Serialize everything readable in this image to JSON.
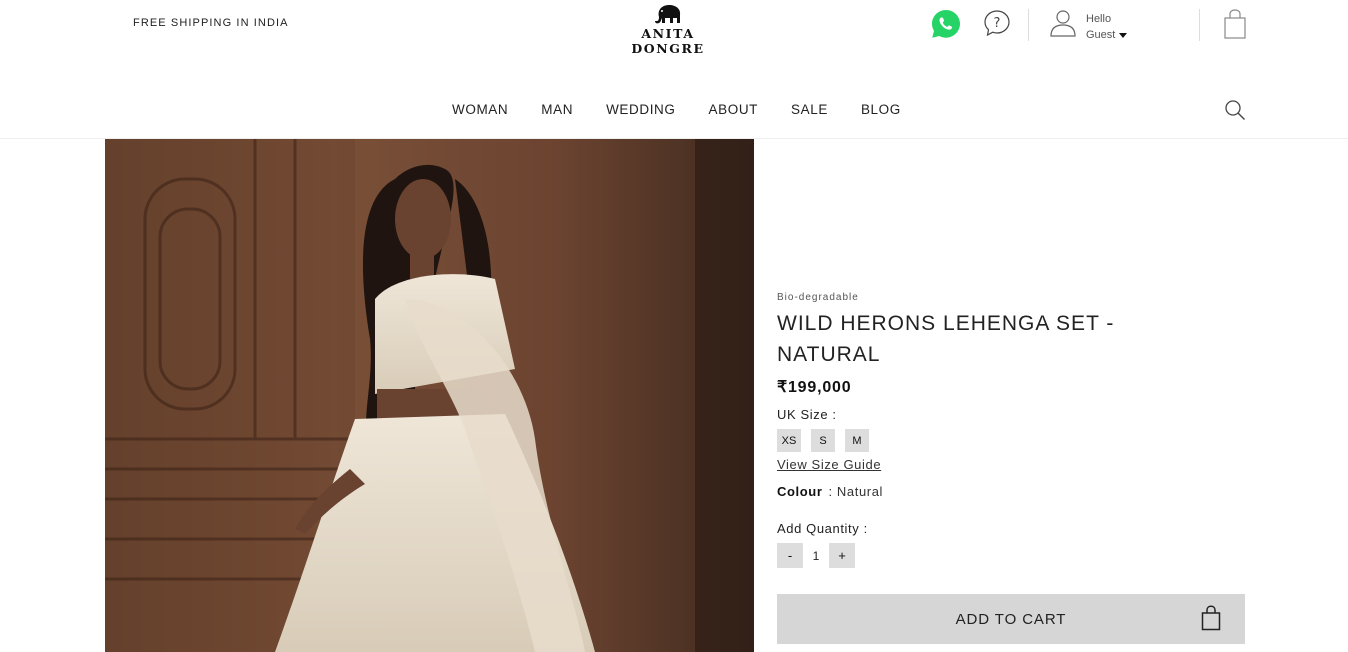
{
  "header": {
    "shipping_note": "FREE SHIPPING IN INDIA",
    "logo_text": "ANITA DONGRE",
    "account_greeting": "Hello",
    "account_name": "Guest",
    "icons": [
      "whatsapp-icon",
      "help-icon",
      "user-icon",
      "cart-icon",
      "search-icon"
    ]
  },
  "nav": {
    "items": [
      "WOMAN",
      "MAN",
      "WEDDING",
      "ABOUT",
      "SALE",
      "BLOG"
    ]
  },
  "product": {
    "tag": "Bio-degradable",
    "title": "WILD HERONS LEHENGA SET - NATURAL",
    "price": "₹199,000",
    "size_label": "UK Size  :",
    "sizes": [
      "XS",
      "S",
      "M"
    ],
    "size_guide": "View Size Guide",
    "colour_label": "Colour",
    "colour_value": ":  Natural",
    "quantity_label": "Add Quantity :",
    "quantity_minus": "-",
    "quantity_value": "1",
    "quantity_plus": "+",
    "add_to_cart": "ADD TO CART"
  },
  "colors": {
    "whatsapp": "#25D366",
    "button_grey": "#d6d6d6",
    "image_bg": "#6b4a35"
  }
}
